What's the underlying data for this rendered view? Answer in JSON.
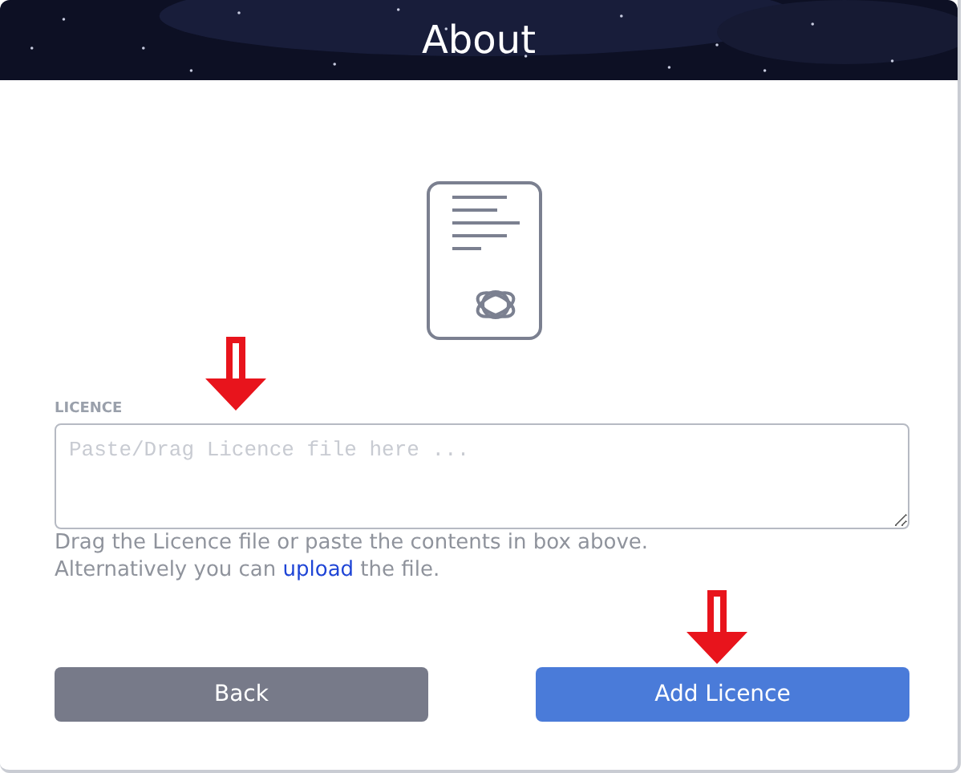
{
  "header": {
    "title": "About"
  },
  "licence": {
    "label": "LICENCE",
    "placeholder": "Paste/Drag Licence file here ...",
    "help_line_1": "Drag the Licence file or paste the contents in box above.",
    "help_line_2_before": "Alternatively you can",
    "help_link": "upload",
    "help_line_2_after": "the file."
  },
  "buttons": [
    {
      "label": "Back",
      "kind": "secondary"
    },
    {
      "label": "Add Licence",
      "kind": "primary"
    }
  ]
}
